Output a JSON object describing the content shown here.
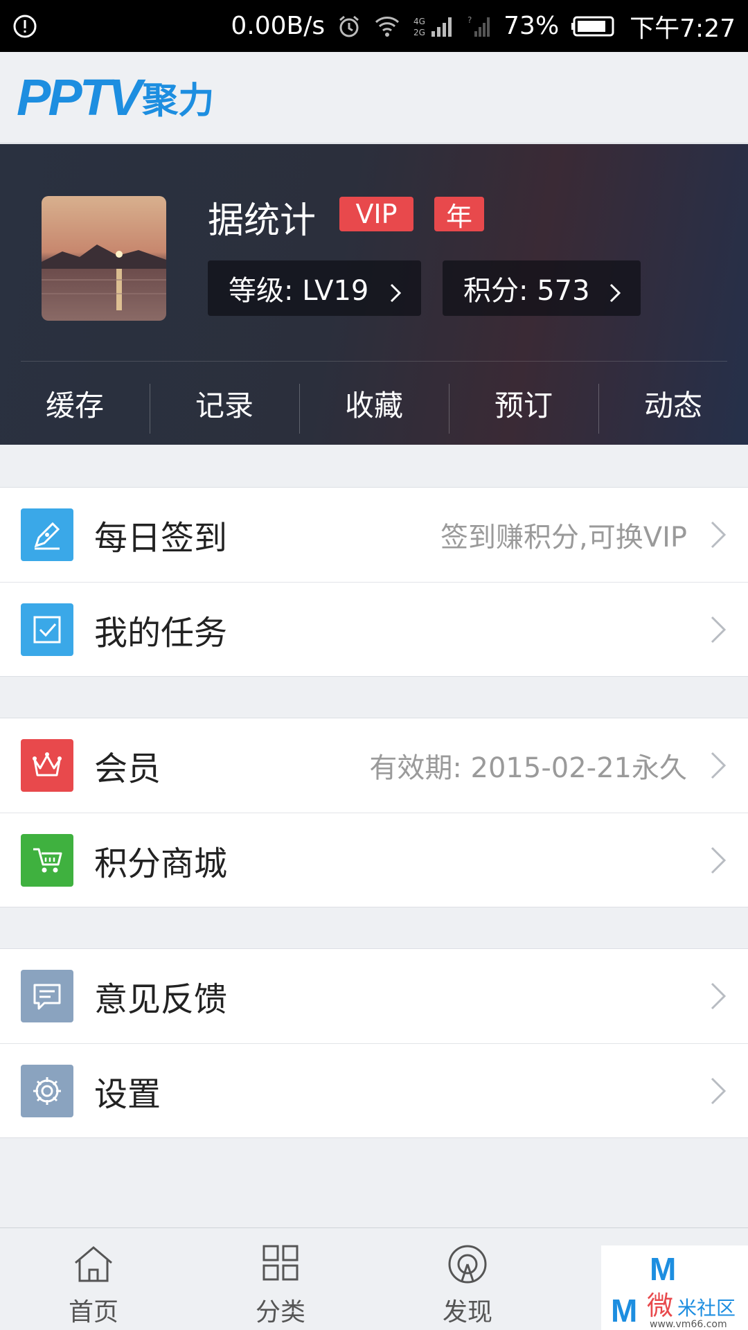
{
  "status_bar": {
    "speed": "0.00B/s",
    "network": "4G 2G",
    "battery": "73%",
    "time": "下午7:27"
  },
  "header": {
    "logo_text": "PPTV",
    "logo_cn": "聚力",
    "brand_color": "#1d8ee0"
  },
  "profile": {
    "name": "据统计",
    "badges": [
      "VIP",
      "年"
    ],
    "level_label": "等级: LV19",
    "points_label": "积分: 573",
    "quick_tabs": [
      "缓存",
      "记录",
      "收藏",
      "预订",
      "动态"
    ]
  },
  "menu": {
    "groups": [
      [
        {
          "icon": "pen-icon",
          "color": "#3aa8e8",
          "label": "每日签到",
          "sub": "签到赚积分,可换VIP"
        },
        {
          "icon": "checkbox-icon",
          "color": "#3aa8e8",
          "label": "我的任务",
          "sub": ""
        }
      ],
      [
        {
          "icon": "crown-icon",
          "color": "#e8494c",
          "label": "会员",
          "sub": "有效期: 2015-02-21永久"
        },
        {
          "icon": "cart-icon",
          "color": "#3fb13f",
          "label": "积分商城",
          "sub": ""
        }
      ],
      [
        {
          "icon": "chat-icon",
          "color": "#8aa3bf",
          "label": "意见反馈",
          "sub": ""
        },
        {
          "icon": "gear-icon",
          "color": "#8aa3bf",
          "label": "设置",
          "sub": ""
        }
      ]
    ]
  },
  "bottom_nav": {
    "items": [
      "首页",
      "分类",
      "发现"
    ]
  }
}
